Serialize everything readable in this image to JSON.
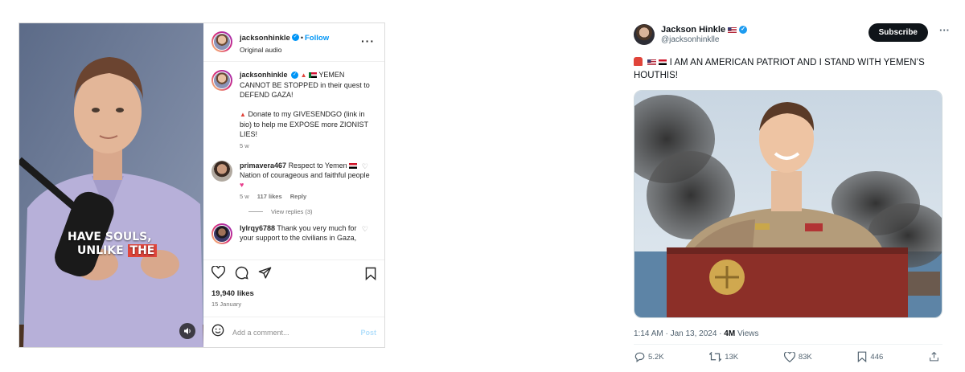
{
  "instagram": {
    "overlay_caption": {
      "line1": "HAVE SOULS,",
      "line2_a": "UNLIKE ",
      "line2_b": "THE"
    },
    "header": {
      "username": "jacksonhinkle",
      "follow_label": "Follow",
      "audio": "Original audio"
    },
    "post": {
      "username": "jacksonhinkle",
      "caption_1": "YEMEN CANNOT BE STOPPED in their quest to DEFEND GAZA!",
      "caption_2": "Donate to my GIVESENDGO (link in bio) to help me EXPOSE more ZIONIST LIES!",
      "time": "5 w"
    },
    "comments": [
      {
        "username": "primavera467",
        "text": "Respect to Yemen",
        "text_2": "Nation of courageous and faithful people",
        "time": "5 w",
        "likes": "117 likes",
        "reply": "Reply"
      },
      {
        "username": "lylrqy6788",
        "text": "Thank you very much for your support to the civilians in Gaza,"
      }
    ],
    "view_replies": "View replies (3)",
    "likes": "19,940 likes",
    "date": "15 January",
    "comment_placeholder": "Add a comment...",
    "post_label": "Post"
  },
  "tweet": {
    "name": "Jackson Hinkle",
    "handle": "@jacksonhinklle",
    "subscribe_label": "Subscribe",
    "text": "I AM AN AMERICAN PATRIOT AND I STAND WITH YEMEN’S HOUTHIS!",
    "time": "1:14 AM · Jan 13, 2024 · ",
    "views_count": "4M",
    "views_label": " Views",
    "stats": {
      "replies": "5.2K",
      "reposts": "13K",
      "likes": "83K",
      "bookmarks": "446"
    }
  },
  "colors": {
    "ig_blue": "#0095f6",
    "x_blue": "#1d9bf0",
    "x_black": "#0f1419"
  }
}
